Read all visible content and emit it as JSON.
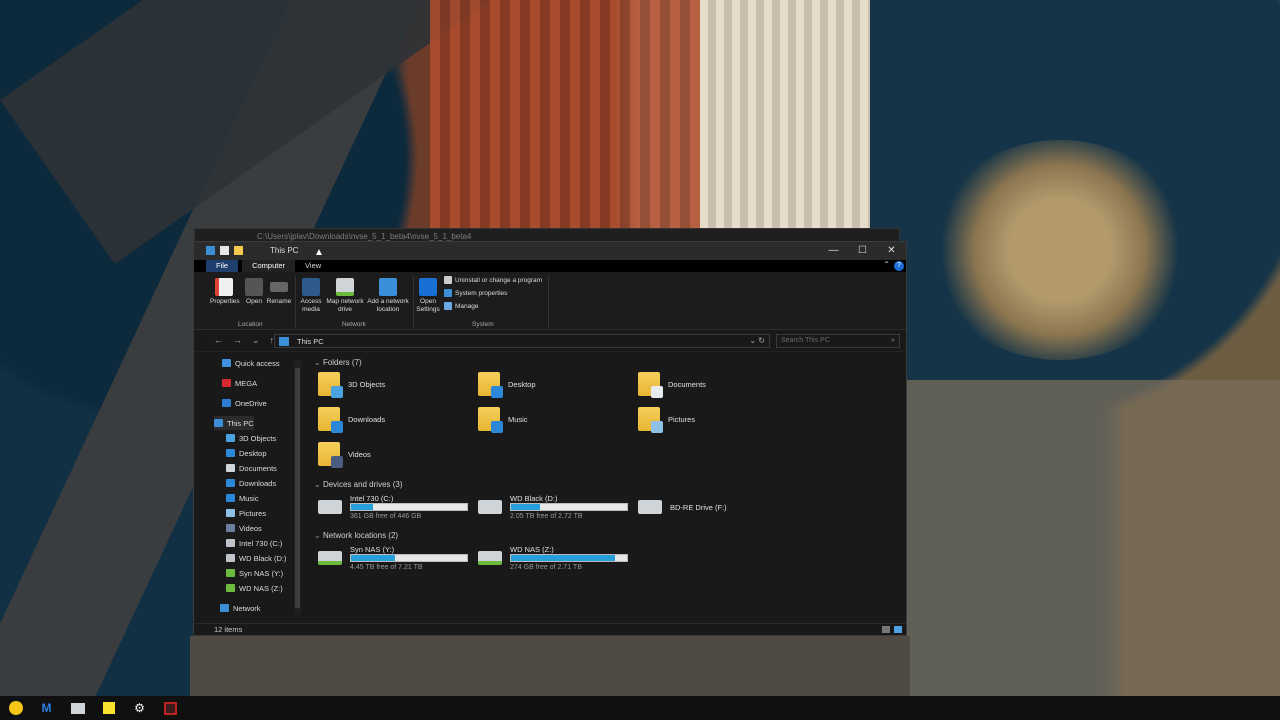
{
  "back_window": {
    "path": "C:\\Users\\jplav\\Downloads\\nvse_5_1_beta4\\nvse_5_1_beta4"
  },
  "window": {
    "title": "This PC",
    "controls": {
      "minimize": "—",
      "maximize": "☐",
      "close": "✕"
    }
  },
  "ribbon_tabs": [
    "File",
    "Computer",
    "View"
  ],
  "ribbon": {
    "location": {
      "label": "Location",
      "properties": "Properties",
      "open": "Open",
      "rename": "Rename"
    },
    "network": {
      "label": "Network",
      "access_media": "Access media",
      "map_drive": "Map network drive",
      "add_location": "Add a network location"
    },
    "system": {
      "label": "System",
      "open_settings": "Open Settings",
      "uninstall": "Uninstall or change a program",
      "system_props": "System properties",
      "manage": "Manage"
    }
  },
  "address": {
    "crumb": "This PC",
    "search_placeholder": "Search This PC"
  },
  "sidebar": [
    {
      "label": "Quick access",
      "icon": "star-icon",
      "color": "#3d8fe0"
    },
    {
      "label": "MEGA",
      "icon": "mega-icon",
      "color": "#d9272e"
    },
    {
      "label": "OneDrive",
      "icon": "cloud-icon",
      "color": "#2c7cd1"
    },
    {
      "label": "This PC",
      "icon": "computer-icon",
      "color": "#3a8fd8"
    },
    {
      "label": "3D Objects",
      "icon": "cube-icon",
      "color": "#4aa3df"
    },
    {
      "label": "Desktop",
      "icon": "desktop-icon",
      "color": "#2b88d8"
    },
    {
      "label": "Documents",
      "icon": "document-icon",
      "color": "#cfd4d8"
    },
    {
      "label": "Downloads",
      "icon": "download-icon",
      "color": "#2b88d8"
    },
    {
      "label": "Music",
      "icon": "music-icon",
      "color": "#2b88d8"
    },
    {
      "label": "Pictures",
      "icon": "picture-icon",
      "color": "#8fc1e6"
    },
    {
      "label": "Videos",
      "icon": "video-icon",
      "color": "#6a7fa0"
    },
    {
      "label": "Intel 730 (C:)",
      "icon": "drive-icon",
      "color": "#bfc5ca"
    },
    {
      "label": "WD Black (D:)",
      "icon": "drive-icon",
      "color": "#bfc5ca"
    },
    {
      "label": "Syn NAS (Y:)",
      "icon": "network-drive-icon",
      "color": "#6dbb3d"
    },
    {
      "label": "WD NAS (Z:)",
      "icon": "network-drive-icon",
      "color": "#6dbb3d"
    },
    {
      "label": "Network",
      "icon": "network-icon",
      "color": "#3a8fd8"
    }
  ],
  "groups": {
    "folders": "Folders (7)",
    "devices": "Devices and drives (3)",
    "network": "Network locations (2)"
  },
  "folders": [
    {
      "name": "3D Objects",
      "badge": "#4aa3df"
    },
    {
      "name": "Desktop",
      "badge": "#2b88d8"
    },
    {
      "name": "Documents",
      "badge": "#e8ecef"
    },
    {
      "name": "Downloads",
      "badge": "#2b88d8"
    },
    {
      "name": "Music",
      "badge": "#2b88d8"
    },
    {
      "name": "Pictures",
      "badge": "#8fc1e6"
    },
    {
      "name": "Videos",
      "badge": "#4a5d80"
    }
  ],
  "drives": [
    {
      "name": "Intel 730 (C:)",
      "free": "361 GB free of 446 GB",
      "used_fraction": 0.19
    },
    {
      "name": "WD Black (D:)",
      "free": "2.05 TB free of 2.72 TB",
      "used_fraction": 0.25
    },
    {
      "name": "BD-RE Drive (F:)",
      "free": "",
      "used_fraction": null
    }
  ],
  "network_drives": [
    {
      "name": "Syn NAS (Y:)",
      "free": "4.45 TB free of 7.21 TB",
      "used_fraction": 0.38
    },
    {
      "name": "WD NAS (Z:)",
      "free": "274 GB free of 2.71 TB",
      "used_fraction": 0.9
    }
  ],
  "status": {
    "items": "12 items"
  },
  "taskbar": [
    "norton-icon",
    "malwarebytes-icon",
    "explorer-icon",
    "sticky-notes-icon",
    "settings-icon",
    "app-icon"
  ]
}
